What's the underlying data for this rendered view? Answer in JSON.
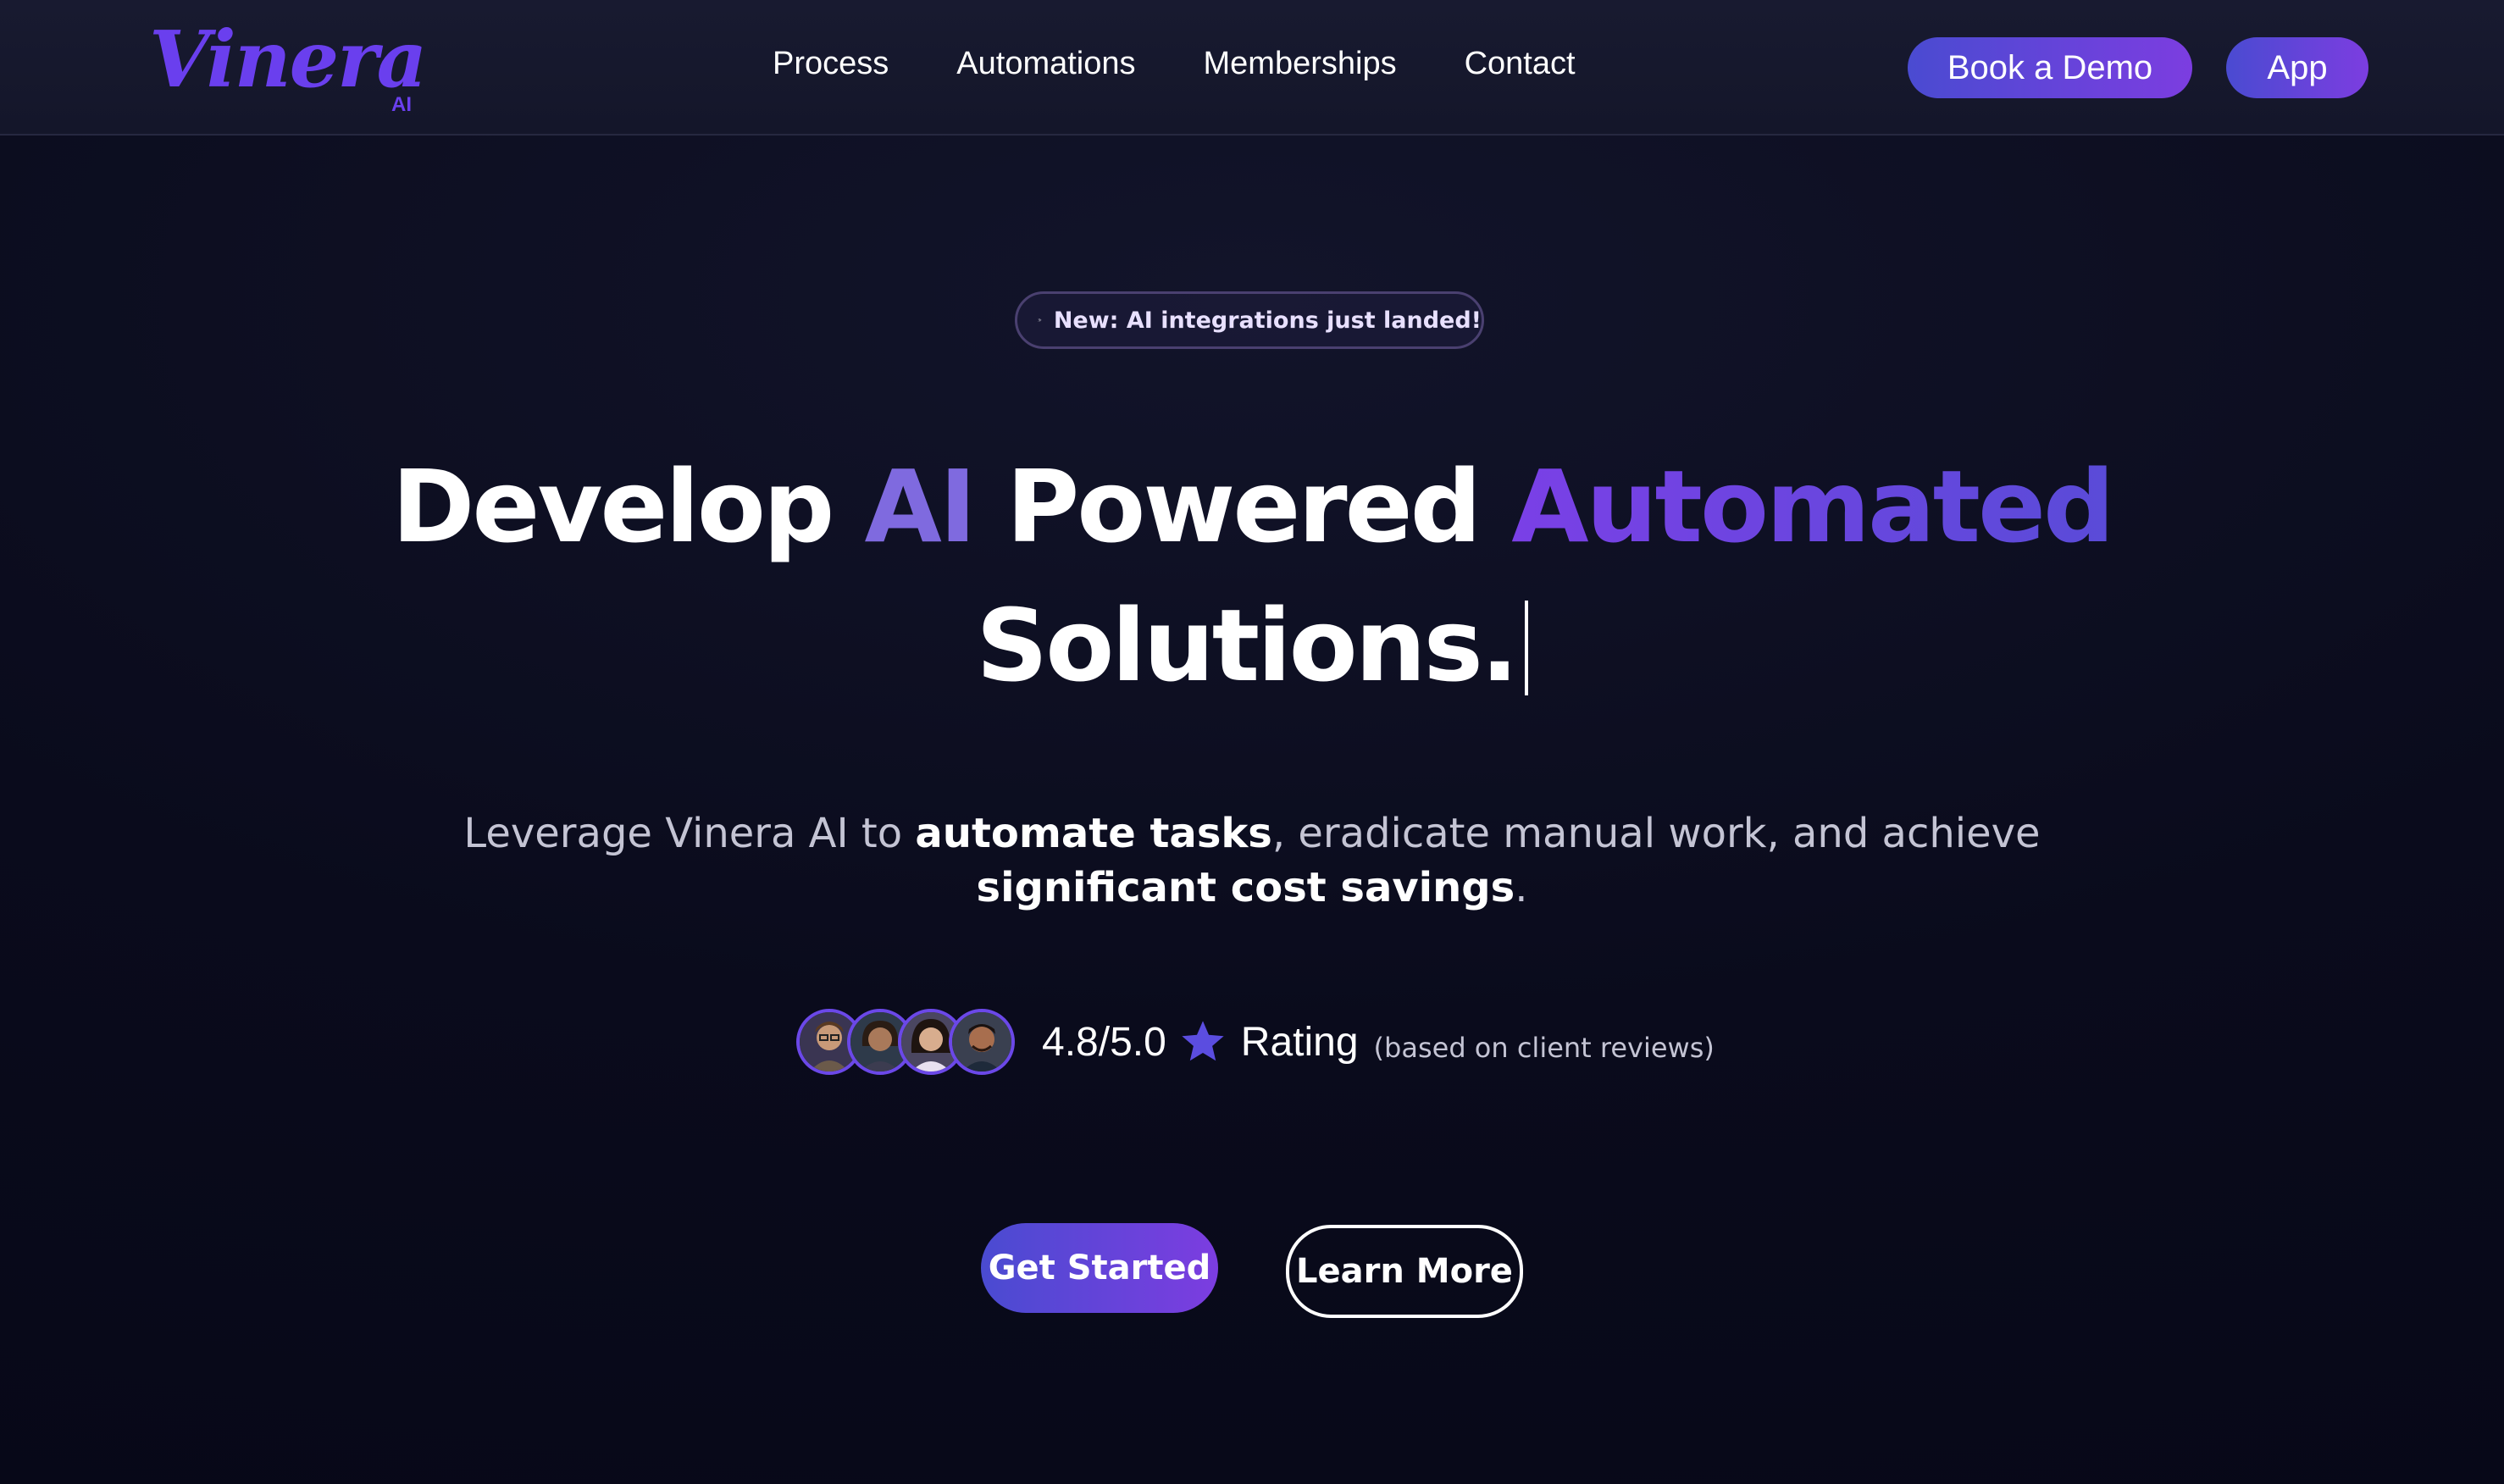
{
  "brand": {
    "logo_text": "Vinera",
    "logo_suffix": "AI",
    "logo_color": "#6a3fee"
  },
  "nav": {
    "items": [
      {
        "label": "Process"
      },
      {
        "label": "Automations"
      },
      {
        "label": "Memberships"
      },
      {
        "label": "Contact"
      }
    ]
  },
  "header_buttons": {
    "demo_label": "Book a Demo",
    "app_label": "App"
  },
  "announcement": {
    "icon": "sparkle-icon",
    "text": "New: AI integrations just landed!"
  },
  "headline": {
    "word1": "Develop",
    "word2": "AI",
    "word3": "Powered",
    "word4": "Automated",
    "line2": "Solutions."
  },
  "subtext": {
    "part1": "Leverage Vinera AI to ",
    "bold1": "automate tasks",
    "part2": ", eradicate manual work, and achieve ",
    "bold2": "significant cost savings",
    "part3": "."
  },
  "rating": {
    "score": "4.8/5.0",
    "label": "Rating",
    "note": "(based on client reviews)",
    "star_icon": "star-icon",
    "avatar_count": 4
  },
  "cta": {
    "primary_label": "Get Started",
    "secondary_label": "Learn More"
  },
  "colors": {
    "background": "#0a0b1c",
    "accent_purple": "#7a40e6",
    "accent_blue": "#4a4bd1",
    "accent_ai_text": "#7f6adf"
  }
}
